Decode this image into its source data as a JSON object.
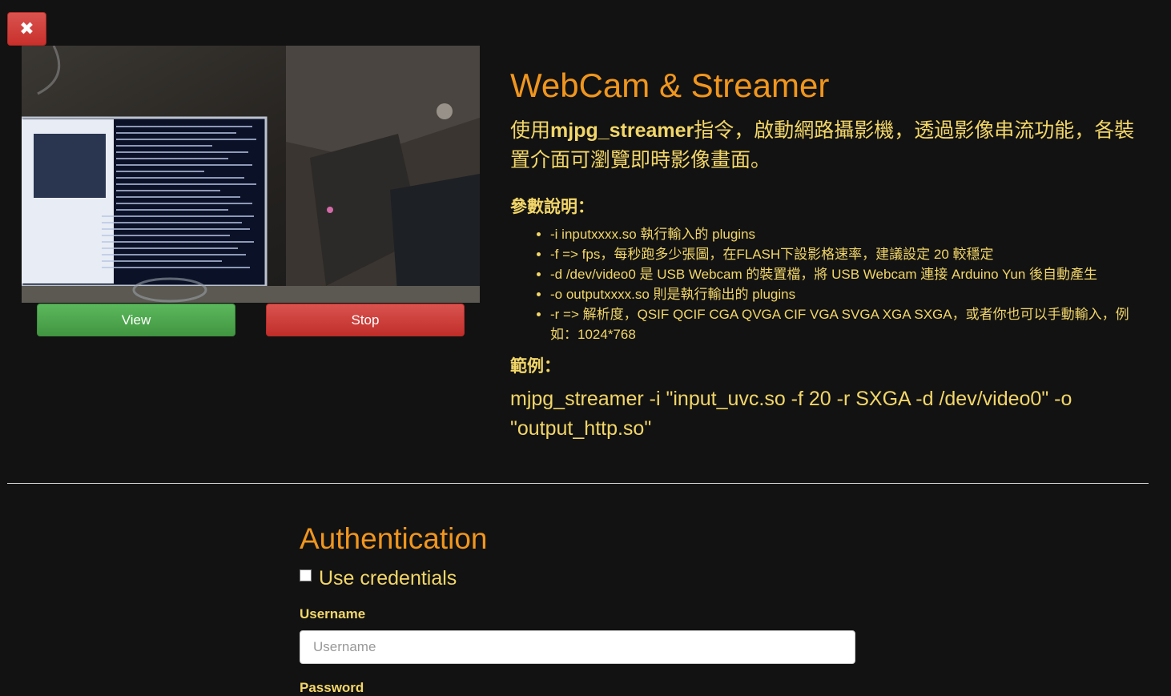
{
  "close_button": {
    "icon": "close-icon",
    "glyph": "✖"
  },
  "webcam": {
    "alt": "live webcam frame"
  },
  "controls": {
    "view_label": "View",
    "stop_label": "Stop"
  },
  "info": {
    "title": "WebCam & Streamer",
    "intro_prefix": "使用",
    "intro_bold": "mjpg_streamer",
    "intro_suffix": "指令，啟動網路攝影機，透過影像串流功能，各裝置介面可瀏覽即時影像畫面。",
    "params_heading": "參數說明：",
    "params": [
      "-i inputxxxx.so 執行輸入的 plugins",
      "-f => fps，每秒跑多少張圖，在FLASH下設影格速率，建議設定 20 較穩定",
      "-d /dev/video0 是 USB Webcam 的裝置檔，將 USB Webcam 連接 Arduino Yun 後自動產生",
      "-o outputxxxx.so 則是執行輸出的 plugins",
      "-r => 解析度，QSIF QCIF CGA QVGA CIF VGA SVGA XGA SXGA，或者你也可以手動輸入，例如：1024*768"
    ],
    "example_heading": "範例：",
    "example_command": "mjpg_streamer -i \"input_uvc.so -f 20 -r SXGA -d /dev/video0\" -o \"output_http.so\""
  },
  "auth": {
    "title": "Authentication",
    "use_credentials_label": "Use credentials",
    "use_credentials_checked": false,
    "username_label": "Username",
    "username_placeholder": "Username",
    "username_value": "",
    "password_label": "Password"
  },
  "colors": {
    "background": "#121212",
    "heading": "#f0961e",
    "text": "#f2d668",
    "view_button": "#5cb85c",
    "stop_button": "#d9534f"
  }
}
